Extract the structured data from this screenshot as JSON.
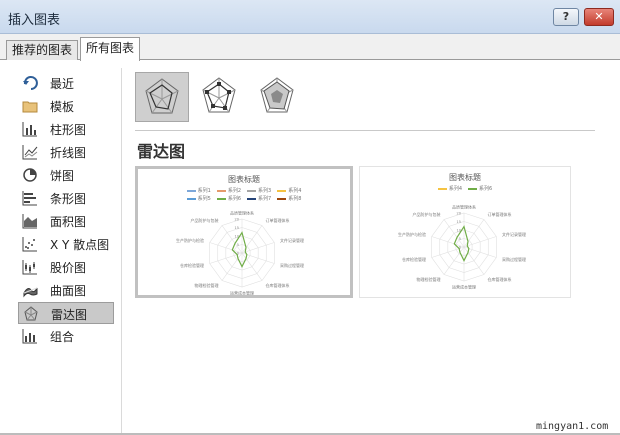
{
  "window": {
    "title": "插入图表",
    "help_label": "?",
    "close_label": "✕"
  },
  "tabs": [
    {
      "label": "推荐的图表",
      "active": false
    },
    {
      "label": "所有图表",
      "active": true
    }
  ],
  "sidebar": {
    "items": [
      {
        "label": "最近",
        "icon": "recent-icon"
      },
      {
        "label": "模板",
        "icon": "folder-icon"
      },
      {
        "label": "柱形图",
        "icon": "column-chart-icon"
      },
      {
        "label": "折线图",
        "icon": "line-chart-icon"
      },
      {
        "label": "饼图",
        "icon": "pie-chart-icon"
      },
      {
        "label": "条形图",
        "icon": "bar-chart-icon"
      },
      {
        "label": "面积图",
        "icon": "area-chart-icon"
      },
      {
        "label": "X Y 散点图",
        "icon": "scatter-chart-icon"
      },
      {
        "label": "股价图",
        "icon": "stock-chart-icon"
      },
      {
        "label": "曲面图",
        "icon": "surface-chart-icon"
      },
      {
        "label": "雷达图",
        "icon": "radar-chart-icon",
        "selected": true
      },
      {
        "label": "组合",
        "icon": "combo-chart-icon"
      }
    ]
  },
  "main": {
    "subtypes": [
      {
        "icon": "radar-icon",
        "selected": true
      },
      {
        "icon": "radar-with-markers-icon",
        "selected": false
      },
      {
        "icon": "filled-radar-icon",
        "selected": false
      }
    ],
    "heading": "雷达图",
    "previews": [
      {
        "title": "图表标题",
        "legend": [
          {
            "label": "系列1",
            "color": "#7da7d9"
          },
          {
            "label": "系列2",
            "color": "#e59a6b"
          },
          {
            "label": "系列3",
            "color": "#a6a6a6"
          },
          {
            "label": "系列4",
            "color": "#f5c342"
          },
          {
            "label": "系列5",
            "color": "#5b9bd5"
          },
          {
            "label": "系列6",
            "color": "#70ad47"
          },
          {
            "label": "系列7",
            "color": "#264478"
          },
          {
            "label": "系列8",
            "color": "#9e480e"
          }
        ],
        "axes": [
          "品质管理体系",
          "订单管理体系",
          "文件记录管理",
          "采购过程管理",
          "仓库管理体系",
          "运营成本管理",
          "物理检验管理",
          "仓库检验管理",
          "生产防护与检验",
          "产品防护与包装"
        ],
        "scale": [
          "20",
          "15",
          "10",
          "5",
          "0"
        ]
      },
      {
        "title": "图表标题",
        "legend": [
          {
            "label": "系列4",
            "color": "#f5c342"
          },
          {
            "label": "系列6",
            "color": "#70ad47"
          }
        ],
        "axes": [
          "品质管理体系",
          "订单管理体系",
          "文件记录管理",
          "采购过程管理",
          "仓库管理体系",
          "运营成本管理",
          "物理检验管理",
          "仓库检验管理",
          "生产防护与检验",
          "产品防护与包装"
        ],
        "scale": [
          "20",
          "15",
          "10",
          "5",
          "0"
        ]
      }
    ]
  },
  "chart_data": {
    "type": "radar",
    "categories": [
      "品质管理体系",
      "订单管理体系",
      "文件记录管理",
      "采购过程管理",
      "仓库管理体系",
      "运营成本管理",
      "物理检验管理",
      "仓库检验管理",
      "生产防护与检验",
      "产品防护与包装"
    ],
    "series": [
      {
        "name": "系列6",
        "values": [
          12,
          4,
          2,
          3,
          4,
          8,
          4,
          3,
          6,
          7
        ],
        "color": "#70ad47"
      }
    ],
    "range": [
      0,
      20
    ]
  },
  "watermark": "mingyan1.com"
}
